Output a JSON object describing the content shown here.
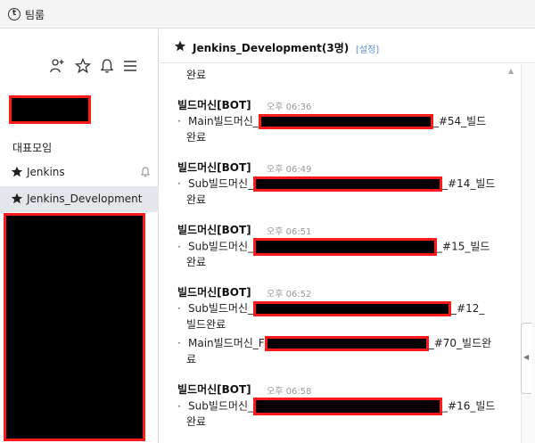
{
  "app": {
    "title": "팀룸",
    "icon": "t-circle-icon"
  },
  "sidebar": {
    "toolbar": [
      "add-user-icon",
      "star-icon",
      "bell-icon",
      "menu-icon"
    ],
    "group_title": "대표모임",
    "rooms": [
      {
        "name": "Jenkins",
        "starred": true,
        "muted": true
      },
      {
        "name": "Jenkins_Development",
        "starred": true,
        "active": true
      }
    ]
  },
  "chat": {
    "title": "Jenkins_Development(3명)",
    "settings_label": "[설정]",
    "top_fragment": "완료",
    "messages": [
      {
        "sender": "빌드머신[BOT]",
        "time": "오후 06:36",
        "lines": [
          {
            "bullet": "·",
            "pre": "Main빌드머신_",
            "post": "_#54_빌드"
          },
          {
            "pre": "완료"
          }
        ]
      },
      {
        "sender": "빌드머신[BOT]",
        "time": "오후 06:49",
        "lines": [
          {
            "bullet": "·",
            "pre": "Sub빌드머신_",
            "post": "_#14_빌드"
          },
          {
            "pre": "완료"
          }
        ]
      },
      {
        "sender": "빌드머신[BOT]",
        "time": "오후 06:51",
        "lines": [
          {
            "bullet": "·",
            "pre": "Sub빌드머신_",
            "post": "_#15_빌드"
          },
          {
            "pre": "완료"
          }
        ]
      },
      {
        "sender": "빌드머신[BOT]",
        "time": "오후 06:52",
        "lines": [
          {
            "bullet": "·",
            "pre": "Sub빌드머신_",
            "post": "_#12_"
          },
          {
            "pre": "빌드완료"
          },
          {
            "bullet": "·",
            "pre": "Main빌드머신_F",
            "post": "_#70_빌드완"
          },
          {
            "pre": "료"
          }
        ]
      },
      {
        "sender": "빌드머신[BOT]",
        "time": "오후 06:58",
        "lines": [
          {
            "bullet": "·",
            "pre": "Sub빌드머신_",
            "post": "_#16_빌드"
          },
          {
            "pre": "완료"
          }
        ]
      }
    ]
  },
  "colors": {
    "redaction_border": "#ff1a1a",
    "active_room_bg": "#e3e6ea",
    "settings_link": "#5a8fd6"
  }
}
